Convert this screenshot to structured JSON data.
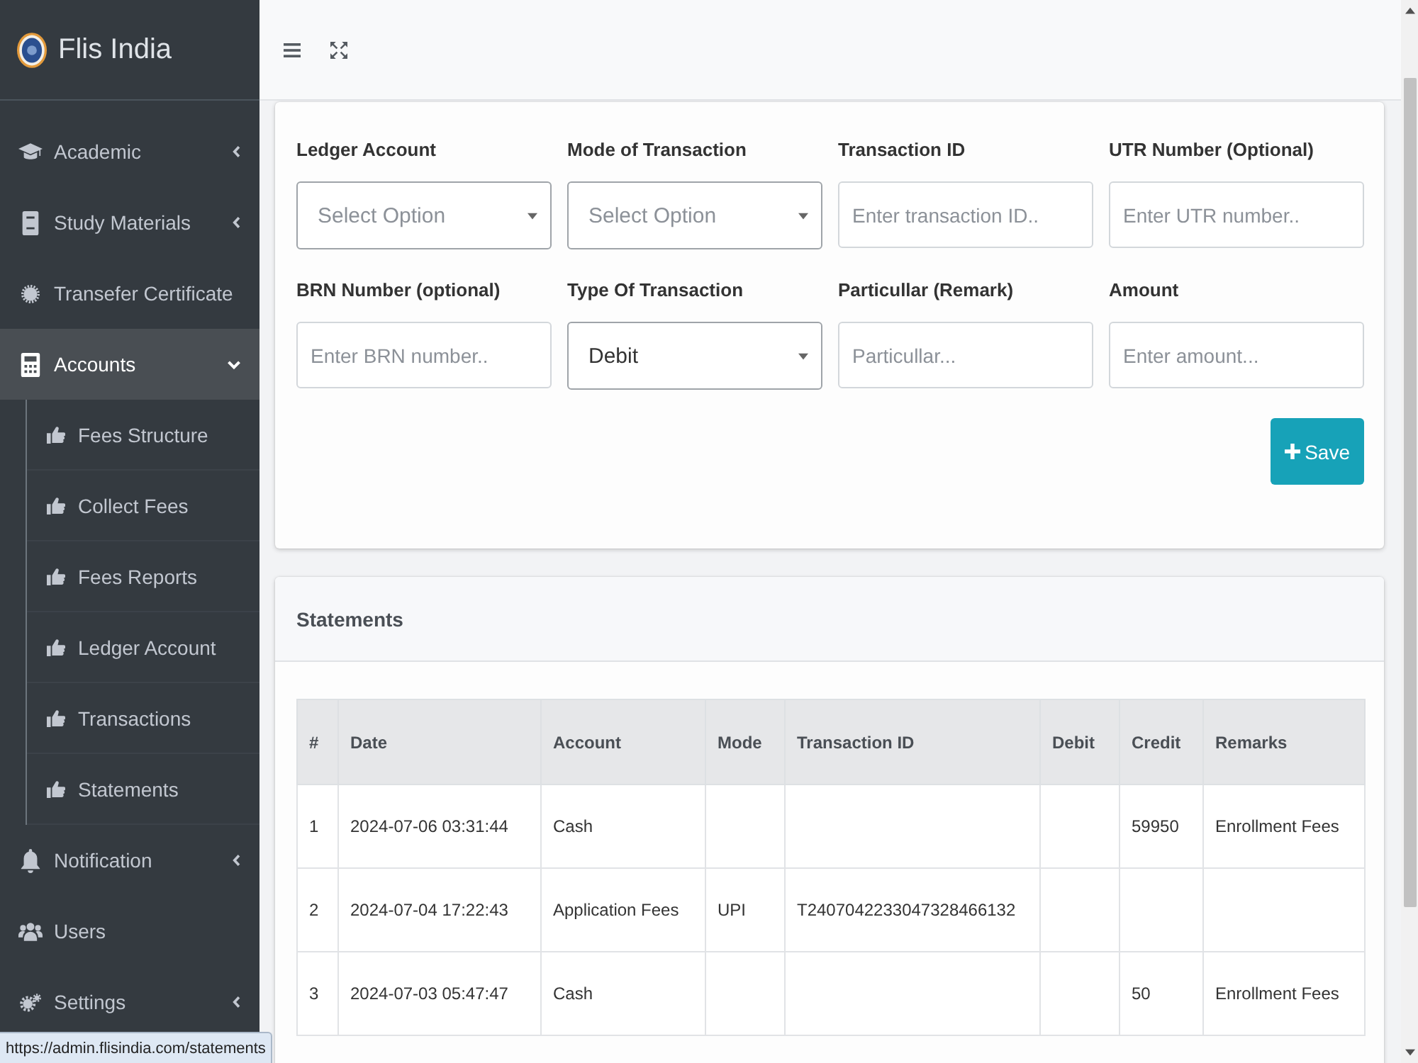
{
  "brand": {
    "name": "Flis India"
  },
  "sidebar": {
    "items": [
      {
        "label": "Academic",
        "kind": "group",
        "expanded": false,
        "selected": false
      },
      {
        "label": "Study Materials",
        "kind": "group",
        "expanded": false,
        "selected": false
      },
      {
        "label": "Transefer Certificate",
        "kind": "link",
        "selected": false
      },
      {
        "label": "Accounts",
        "kind": "group",
        "expanded": true,
        "selected": true,
        "children": [
          {
            "label": "Fees Structure"
          },
          {
            "label": "Collect Fees"
          },
          {
            "label": "Fees Reports"
          },
          {
            "label": "Ledger Account"
          },
          {
            "label": "Transactions"
          },
          {
            "label": "Statements"
          }
        ]
      },
      {
        "label": "Notification",
        "kind": "group",
        "expanded": false,
        "selected": false
      },
      {
        "label": "Users",
        "kind": "link",
        "selected": false
      },
      {
        "label": "Settings",
        "kind": "group",
        "expanded": false,
        "selected": false
      }
    ]
  },
  "form": {
    "fields": [
      {
        "label": "Ledger Account",
        "kind": "select",
        "placeholder": "Select Option"
      },
      {
        "label": "Mode of Transaction",
        "kind": "select",
        "placeholder": "Select Option"
      },
      {
        "label": "Transaction ID",
        "kind": "text",
        "placeholder": "Enter transaction ID.."
      },
      {
        "label": "UTR Number (Optional)",
        "kind": "text",
        "placeholder": "Enter UTR number.."
      },
      {
        "label": "BRN Number (optional)",
        "kind": "text",
        "placeholder": "Enter BRN number.."
      },
      {
        "label": "Type Of Transaction",
        "kind": "select",
        "value": "Debit"
      },
      {
        "label": "Particullar (Remark)",
        "kind": "text",
        "placeholder": "Particullar..."
      },
      {
        "label": "Amount",
        "kind": "text",
        "placeholder": "Enter amount..."
      }
    ],
    "save_button": "Save"
  },
  "statements": {
    "title": "Statements",
    "table": {
      "columns": [
        "#",
        "Date",
        "Account",
        "Mode",
        "Transaction ID",
        "Debit",
        "Credit",
        "Remarks"
      ],
      "rows": [
        {
          "no": "1",
          "date": "2024-07-06 03:31:44",
          "account": "Cash",
          "credit": "59950",
          "remarks": "Enrollment Fees"
        },
        {
          "no": "2",
          "date": "2024-07-04 17:22:43",
          "account": "Application Fees",
          "mode": "UPI",
          "transaction_id": "T2407042233047328466132"
        },
        {
          "no": "3",
          "date": "2024-07-03 05:47:47",
          "account": "Cash",
          "credit": "50",
          "remarks": "Enrollment Fees"
        }
      ]
    }
  },
  "status_url": "https://admin.flisindia.com/statements"
}
